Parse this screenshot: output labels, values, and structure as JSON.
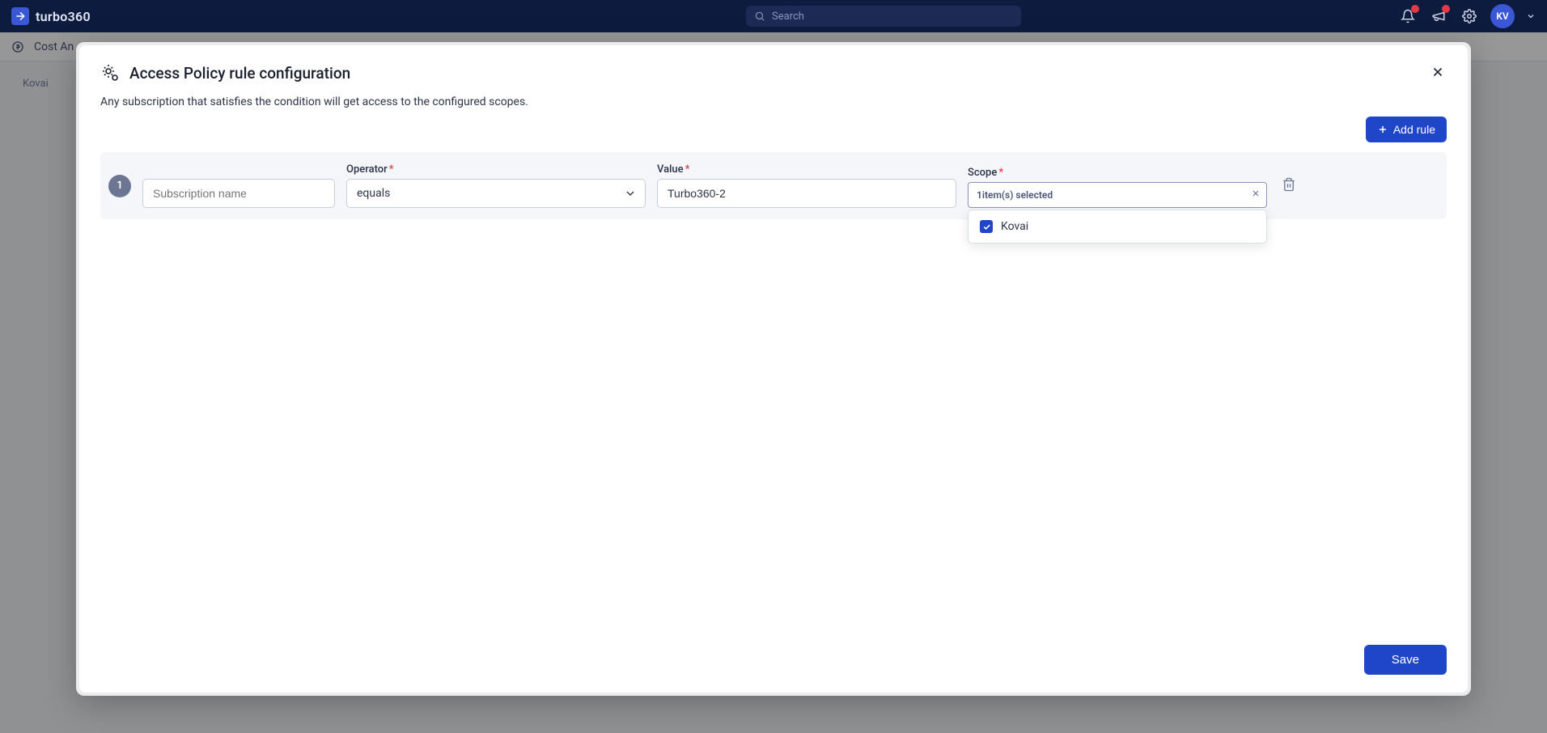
{
  "topbar": {
    "brand": "turbo360",
    "search_placeholder": "Search",
    "avatar_initials": "KV"
  },
  "bg_page": {
    "crumb1": "Cost An",
    "crumb2": "Kovai"
  },
  "modal": {
    "title": "Access Policy rule configuration",
    "subtitle": "Any subscription that satisfies the condition will get access to the configured scopes.",
    "add_rule_label": "Add rule",
    "save_label": "Save"
  },
  "labels": {
    "operator": "Operator",
    "value": "Value",
    "scope": "Scope"
  },
  "rule": {
    "index": "1",
    "subscription_field_placeholder": "Subscription name",
    "operator_value": "equals",
    "value_value": "Turbo360-2",
    "scope_summary": "1item(s) selected",
    "scope_options": [
      {
        "label": "Kovai",
        "checked": true
      }
    ]
  }
}
